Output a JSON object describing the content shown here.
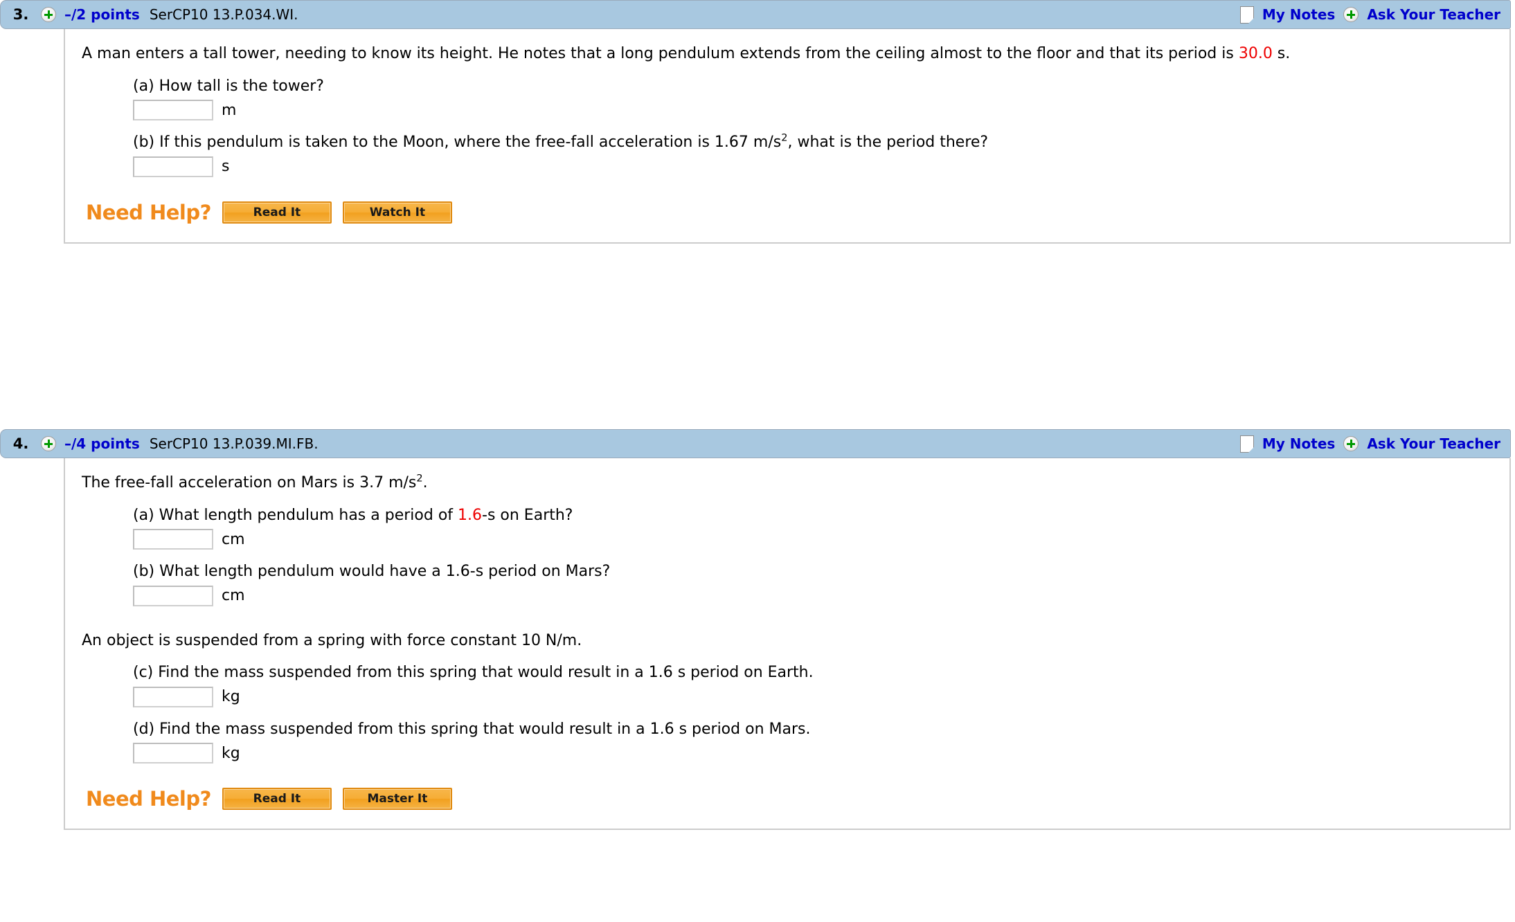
{
  "questions": [
    {
      "number": "3.",
      "points": "–/2 points",
      "code": "SerCP10 13.P.034.WI.",
      "my_notes_label": "My Notes",
      "ask_teacher_label": "Ask Your Teacher",
      "stem_pre": "A man enters a tall tower, needing to know its height. He notes that a long pendulum extends from the ceiling almost to the floor and that its period is ",
      "stem_value": "30.0",
      "stem_post": " s.",
      "parts": [
        {
          "label": "(a) How tall is the tower?",
          "value": "",
          "placeholder": "",
          "unit": "m"
        },
        {
          "label_pre": "(b) If this pendulum is taken to the Moon, where the free-fall acceleration is 1.67 m/s",
          "label_sup": "2",
          "label_post": ", what is the period there?",
          "value": "",
          "placeholder": "",
          "unit": "s"
        }
      ],
      "need_help_label": "Need Help?",
      "help_buttons": [
        "Read It",
        "Watch It"
      ]
    },
    {
      "number": "4.",
      "points": "–/4 points",
      "code": "SerCP10 13.P.039.MI.FB.",
      "my_notes_label": "My Notes",
      "ask_teacher_label": "Ask Your Teacher",
      "stem_pre": "The free-fall acceleration on Mars is 3.7 m/s",
      "stem_sup": "2",
      "stem_post": ".",
      "stem2": "An object is suspended from a spring with force constant 10 N/m.",
      "parts": [
        {
          "label_pre": "(a) What length pendulum has a period of ",
          "label_red": "1.6",
          "label_post": "-s on Earth?",
          "value": "",
          "placeholder": "",
          "unit": "cm"
        },
        {
          "label": "(b) What length pendulum would have a 1.6-s period on Mars?",
          "value": "",
          "placeholder": "",
          "unit": "cm"
        },
        {
          "label": "(c) Find the mass suspended from this spring that would result in a 1.6 s period on Earth.",
          "value": "",
          "placeholder": "",
          "unit": "kg"
        },
        {
          "label": "(d) Find the mass suspended from this spring that would result in a 1.6 s period on Mars.",
          "value": "",
          "placeholder": "",
          "unit": "kg"
        }
      ],
      "need_help_label": "Need Help?",
      "help_buttons": [
        "Read It",
        "Master It"
      ]
    }
  ]
}
